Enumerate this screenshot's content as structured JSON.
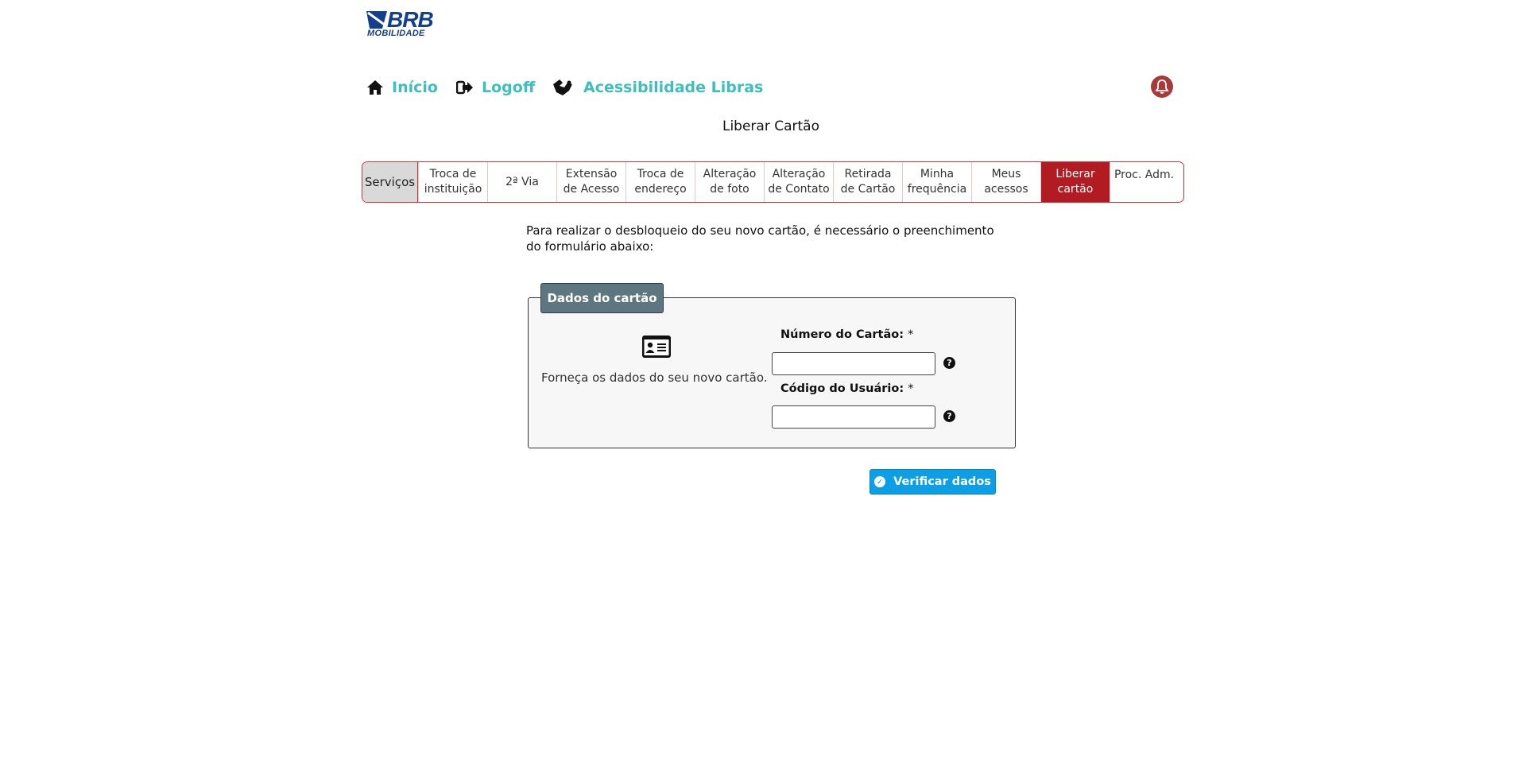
{
  "brand": {
    "name": "BRB",
    "subtitle": "MOBILIDADE"
  },
  "nav": {
    "home": "Início",
    "logoff": "Logoff",
    "libras": "Acessibilidade Libras"
  },
  "page_title": "Liberar Cartão",
  "tabs": [
    "Serviços",
    "Troca de\ninstituição",
    "2ª Via",
    "Extensão\nde Acesso",
    "Troca de\nendereço",
    "Alteração\nde foto",
    "Alteração\nde Contato",
    "Retirada\nde Cartão",
    "Minha\nfrequência",
    "Meus\nacessos",
    "Liberar\ncartão",
    "Proc. Adm."
  ],
  "active_tab": "Liberar\ncartão",
  "intro_text": "Para realizar o desbloqueio do seu novo cartão, é necessário o preenchimento do formulário abaixo:",
  "form": {
    "legend": "Dados do cartão",
    "helper": "Forneça os dados do seu novo cartão.",
    "numero_label": "Número do Cartão:",
    "codigo_label": "Código do Usuário:",
    "required_mark": "*",
    "numero_value": "",
    "codigo_value": "",
    "help_glyph": "?"
  },
  "submit_label": "Verificar dados",
  "colors": {
    "nav_text": "#3dbfbf",
    "active_tab": "#b31b23",
    "tab_border": "#d0323c",
    "legend_bg": "#5e7680",
    "button": "#0d9fe6",
    "brand": "#143f8c"
  },
  "icons": {
    "home": "home-icon",
    "logoff": "sign-out-icon",
    "libras": "sign-language-icon",
    "bell": "bell-icon",
    "card": "id-card-icon",
    "help": "question-circle-icon",
    "check": "check-circle-icon"
  }
}
